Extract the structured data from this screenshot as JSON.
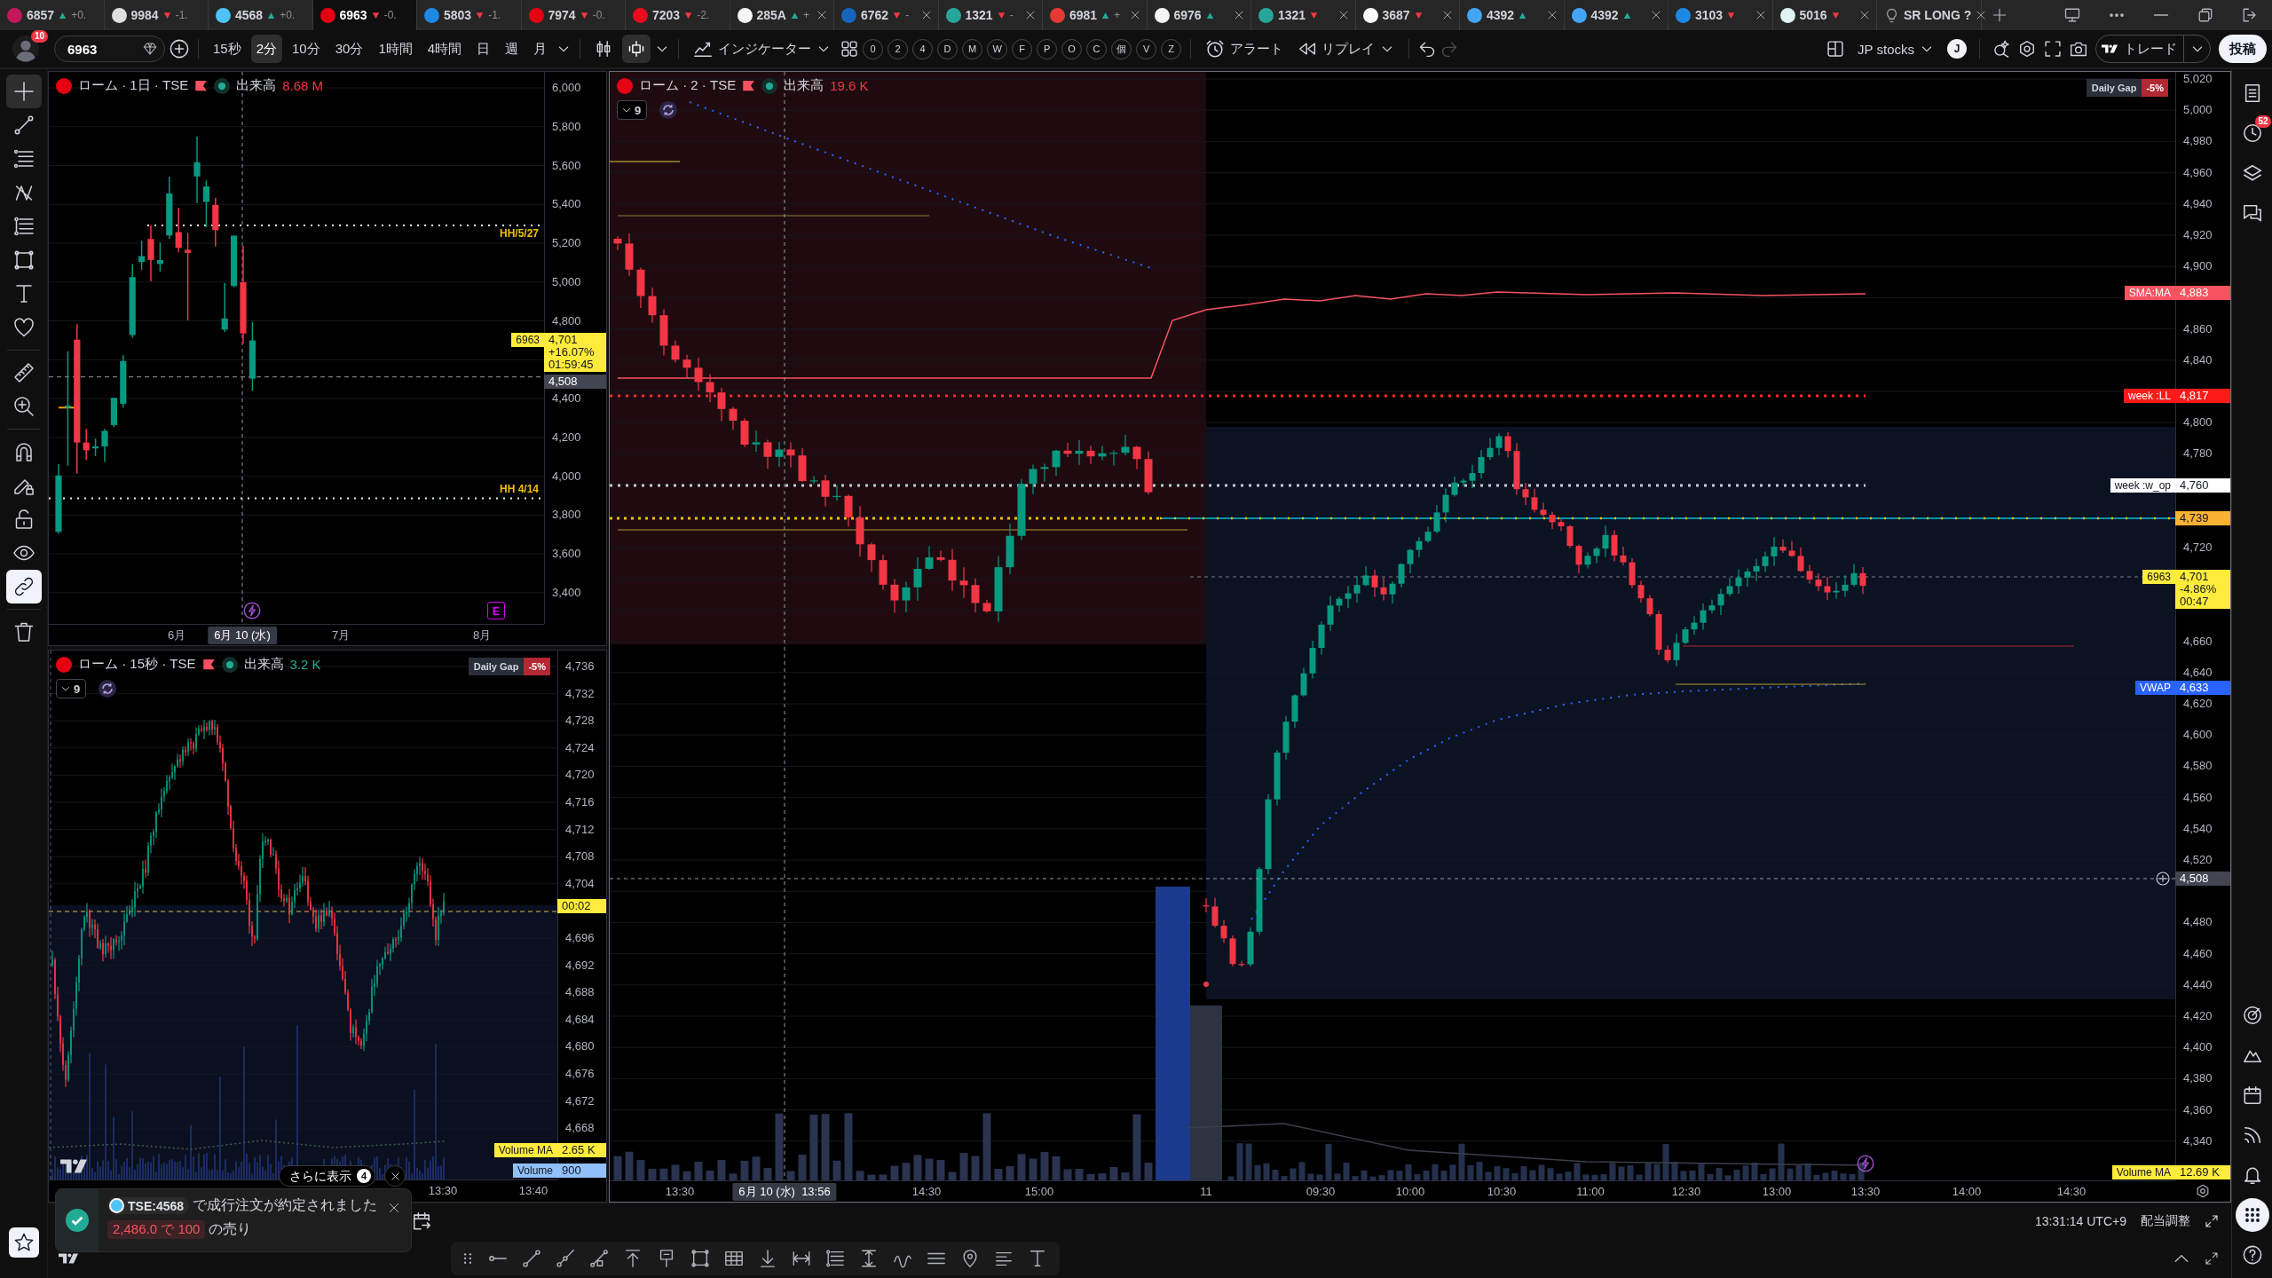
{
  "tabs": [
    {
      "kind": "symbol",
      "symbol": "6857",
      "color": "#c2185b",
      "up": true,
      "change": "+0.",
      "selected": false,
      "closable": false
    },
    {
      "kind": "symbol",
      "symbol": "9984",
      "color": "#e0e0e0",
      "up": false,
      "change": "-1.",
      "selected": false,
      "closable": false
    },
    {
      "kind": "symbol",
      "symbol": "4568",
      "color": "#4fc3f7",
      "up": true,
      "change": "+0.",
      "selected": false,
      "closable": false
    },
    {
      "kind": "symbol",
      "symbol": "6963",
      "color": "#e60012",
      "up": false,
      "change": "-0.",
      "selected": true,
      "closable": false
    },
    {
      "kind": "symbol",
      "symbol": "5803",
      "color": "#1e88e5",
      "up": false,
      "change": "-1.",
      "selected": false,
      "closable": false
    },
    {
      "kind": "symbol",
      "symbol": "7974",
      "color": "#e60012",
      "up": false,
      "change": "-0.",
      "selected": false,
      "closable": false
    },
    {
      "kind": "symbol",
      "symbol": "7203",
      "color": "#eb0a1e",
      "up": false,
      "change": "-2.",
      "selected": false,
      "closable": false
    },
    {
      "kind": "symbol",
      "symbol": "285A",
      "color": "#f5f5f5",
      "up": true,
      "change": "+",
      "selected": false,
      "closable": true
    },
    {
      "kind": "symbol",
      "symbol": "6762",
      "color": "#1565c0",
      "up": false,
      "change": "-",
      "selected": false,
      "closable": true
    },
    {
      "kind": "symbol",
      "symbol": "1321",
      "color": "#26a69a",
      "up": false,
      "change": "-",
      "selected": false,
      "closable": true
    },
    {
      "kind": "symbol",
      "symbol": "6981",
      "color": "#e53935",
      "up": true,
      "change": "+",
      "selected": false,
      "closable": true
    },
    {
      "kind": "symbol",
      "symbol": "6976",
      "color": "#f5f5f5",
      "up": true,
      "selected": false,
      "closable": true
    },
    {
      "kind": "symbol",
      "symbol": "1321",
      "color": "#26a69a",
      "up": false,
      "selected": false,
      "closable": true
    },
    {
      "kind": "symbol",
      "symbol": "3687",
      "color": "#fafafa",
      "up": false,
      "selected": false,
      "closable": true
    },
    {
      "kind": "symbol",
      "symbol": "4392",
      "color": "#42a5f5",
      "up": true,
      "selected": false,
      "closable": true
    },
    {
      "kind": "symbol",
      "symbol": "4392",
      "color": "#42a5f5",
      "up": true,
      "selected": false,
      "closable": true
    },
    {
      "kind": "symbol",
      "symbol": "3103",
      "color": "#1e88e5",
      "up": false,
      "selected": false,
      "closable": true
    },
    {
      "kind": "symbol",
      "symbol": "5016",
      "color": "#e0f2f1",
      "up": false,
      "selected": false,
      "closable": true
    },
    {
      "kind": "script",
      "symbol": "SR LONG ?",
      "color": "#9e9e9e",
      "selected": false,
      "closable": true
    }
  ],
  "toolbar": {
    "avatar_badge": "10",
    "symbol": "6963",
    "intervals": [
      {
        "label": "15秒",
        "selected": false
      },
      {
        "label": "2分",
        "selected": true
      },
      {
        "label": "10分",
        "selected": false
      },
      {
        "label": "30分",
        "selected": false
      },
      {
        "label": "1時間",
        "selected": false
      },
      {
        "label": "4時間",
        "selected": false
      },
      {
        "label": "日",
        "selected": false
      },
      {
        "label": "週",
        "selected": false
      },
      {
        "label": "月",
        "selected": false
      }
    ],
    "chart_types": [
      {
        "kind": "bars",
        "selected": false
      },
      {
        "kind": "candles",
        "selected": true
      }
    ],
    "indicators": "インジケーター",
    "quick_buttons": [
      "0",
      "2",
      "4",
      "D",
      "M",
      "W",
      "F",
      "P",
      "O",
      "C",
      "個",
      "V",
      "Z"
    ],
    "alert": "アラート",
    "replay": "リプレイ",
    "history": [
      {
        "kind": "undo",
        "disabled": false
      },
      {
        "kind": "redo",
        "disabled": true
      }
    ],
    "watchlist": "JP stocks",
    "account": "J",
    "trade": "トレード",
    "publish": "投稿"
  },
  "drawing_tools": {
    "tools": [
      {
        "kind": "crosshair",
        "selected": true
      },
      {
        "kind": "trend-line",
        "selected": false
      },
      {
        "kind": "horizontal-lines",
        "selected": false
      },
      {
        "kind": "pattern",
        "selected": false
      },
      {
        "kind": "fib",
        "selected": false
      },
      {
        "kind": "rectangle",
        "selected": false
      },
      {
        "kind": "text",
        "selected": false
      },
      {
        "kind": "favorite",
        "selected": false
      }
    ],
    "measure": [
      {
        "kind": "ruler",
        "selected": false
      },
      {
        "kind": "zoom",
        "selected": false
      }
    ],
    "toggles": [
      {
        "kind": "magnet",
        "on": false
      },
      {
        "kind": "drawing-lock",
        "on": false
      },
      {
        "kind": "lock",
        "on": false
      },
      {
        "kind": "visibility",
        "on": false
      },
      {
        "kind": "sync",
        "on": true
      }
    ],
    "actions": [
      {
        "kind": "delete"
      }
    ],
    "favorites": {
      "on": true
    }
  },
  "charts": [
    {
      "kind": "daily",
      "title": "ローム · 1日 · TSE",
      "volume_label": "出来高",
      "volume": "8.68 M",
      "volume_up": false,
      "price_ticks": [
        "6,000",
        "5,800",
        "5,600",
        "5,400",
        "5,200",
        "5,000",
        "4,800",
        "4,400",
        "4,200",
        "4,000",
        "3,800",
        "3,600",
        "3,400"
      ],
      "price_labels": [
        {
          "kind": "current",
          "tag": "6963",
          "lines": [
            "4,701",
            "+16.07%",
            "01:59:45"
          ],
          "color": "#ffeb3b"
        },
        {
          "kind": "crosshair",
          "lines": [
            "4,508"
          ]
        }
      ],
      "line_labels": [
        "HH/5/27",
        "HH 4/14"
      ],
      "events": [
        {
          "kind": "lightning"
        },
        {
          "kind": "earnings",
          "label": "E"
        }
      ],
      "time_ticks": [
        {
          "kind": "tick",
          "label": "6月"
        },
        {
          "kind": "crosshair",
          "label": "6月 10 (水)"
        },
        {
          "kind": "tick",
          "label": "7月"
        },
        {
          "kind": "tick",
          "label": "8月"
        }
      ]
    },
    {
      "kind": "tick",
      "title": "ローム · 15秒 · TSE",
      "volume_label": "出来高",
      "volume": "3.2 K",
      "volume_up": true,
      "collapsed_count": "9",
      "daily_gap": {
        "label": "Daily Gap",
        "value": "-5%"
      },
      "price_ticks": [
        "4,736",
        "4,732",
        "4,728",
        "4,724",
        "4,720",
        "4,716",
        "4,712",
        "4,708",
        "4,704",
        "4,696",
        "4,692",
        "4,688",
        "4,684",
        "4,680",
        "4,676",
        "4,672",
        "4,668"
      ],
      "price_labels": [
        {
          "kind": "current",
          "lines": [
            "00:02"
          ],
          "color": "#ffeb3b"
        },
        {
          "kind": "study",
          "tag": "Volume MA",
          "lines": [
            "2.65 K"
          ],
          "color": "#ffeb3b"
        },
        {
          "kind": "study",
          "tag": "Volume",
          "lines": [
            "900"
          ],
          "color": "#90bff9"
        }
      ],
      "time_ticks": [
        {
          "kind": "tick",
          "label": "13:30"
        },
        {
          "kind": "tick",
          "label": "13:40"
        }
      ]
    },
    {
      "kind": "intraday",
      "title": "ローム · 2 · TSE",
      "volume_label": "出来高",
      "volume": "19.6 K",
      "volume_up": false,
      "collapsed_count": "9",
      "daily_gap": {
        "label": "Daily Gap",
        "value": "-5%"
      },
      "price_ticks": [
        "5,020",
        "5,000",
        "4,980",
        "4,960",
        "4,940",
        "4,920",
        "4,900",
        "4,860",
        "4,840",
        "4,800",
        "4,780",
        "4,720",
        "4,660",
        "4,640",
        "4,620",
        "4,600",
        "4,580",
        "4,560",
        "4,540",
        "4,520",
        "4,480",
        "4,460",
        "4,440",
        "4,420",
        "4,400",
        "4,380",
        "4,360",
        "4,340"
      ],
      "price_labels": [
        {
          "kind": "study",
          "tag": "SMA:MA",
          "lines": [
            "4,883"
          ],
          "color": "#f7525f"
        },
        {
          "kind": "study",
          "tag": "week :LL",
          "lines": [
            "4,817"
          ],
          "color": "#ff1a1a"
        },
        {
          "kind": "study",
          "tag": "week :w_op",
          "lines": [
            "4,760"
          ],
          "color": "#ffffff"
        },
        {
          "kind": "study",
          "lines": [
            "4,739"
          ],
          "color": "#f9b233"
        },
        {
          "kind": "current",
          "tag": "6963",
          "lines": [
            "4,701",
            "-4.86%",
            "00:47"
          ],
          "color": "#ffeb3b"
        },
        {
          "kind": "study",
          "tag": "VWAP",
          "lines": [
            "4,633"
          ],
          "color": "#2962ff"
        },
        {
          "kind": "crosshair",
          "lines": [
            "4,508"
          ]
        },
        {
          "kind": "study",
          "tag": "Volume MA",
          "lines": [
            "12.69 K"
          ],
          "color": "#ffeb3b"
        }
      ],
      "events": [
        {
          "kind": "lightning"
        }
      ],
      "time_ticks": [
        {
          "kind": "tick",
          "label": "13:30"
        },
        {
          "kind": "crosshair",
          "label": "6月 10 (水)  13:56"
        },
        {
          "kind": "tick",
          "label": "14:30"
        },
        {
          "kind": "tick",
          "label": "15:00"
        },
        {
          "kind": "tick",
          "label": "11"
        },
        {
          "kind": "tick",
          "label": "09:30"
        },
        {
          "kind": "tick",
          "label": "10:00"
        },
        {
          "kind": "tick",
          "label": "10:30"
        },
        {
          "kind": "tick",
          "label": "11:00"
        },
        {
          "kind": "tick",
          "label": "12:30"
        },
        {
          "kind": "tick",
          "label": "13:00"
        },
        {
          "kind": "tick",
          "label": "13:30"
        },
        {
          "kind": "tick",
          "label": "14:00"
        },
        {
          "kind": "tick",
          "label": "14:30"
        }
      ]
    }
  ],
  "right_rail": {
    "top": [
      {
        "kind": "watchlist",
        "selected": false
      },
      {
        "kind": "alerts",
        "selected": false,
        "badge": "52"
      },
      {
        "kind": "object-tree",
        "selected": false
      },
      {
        "kind": "chat",
        "selected": false
      }
    ],
    "bottom": [
      {
        "kind": "screener",
        "selected": false
      },
      {
        "kind": "ideas",
        "selected": false
      },
      {
        "kind": "calendar",
        "selected": false
      },
      {
        "kind": "streams",
        "selected": false
      },
      {
        "kind": "notifications",
        "selected": false
      },
      {
        "kind": "apps",
        "selected": true
      },
      {
        "kind": "help",
        "selected": false
      }
    ]
  },
  "status_bar": {
    "clock": "13:31:14 UTC+9",
    "adjustment": "配当調整"
  },
  "notifications": {
    "more_label": "さらに表示",
    "more_count": "4",
    "toast": {
      "symbol": "TSE:4568",
      "message": "で成行注文が約定されました",
      "detail": "2,486.0 で 100",
      "detail_suffix": "の売り"
    }
  }
}
